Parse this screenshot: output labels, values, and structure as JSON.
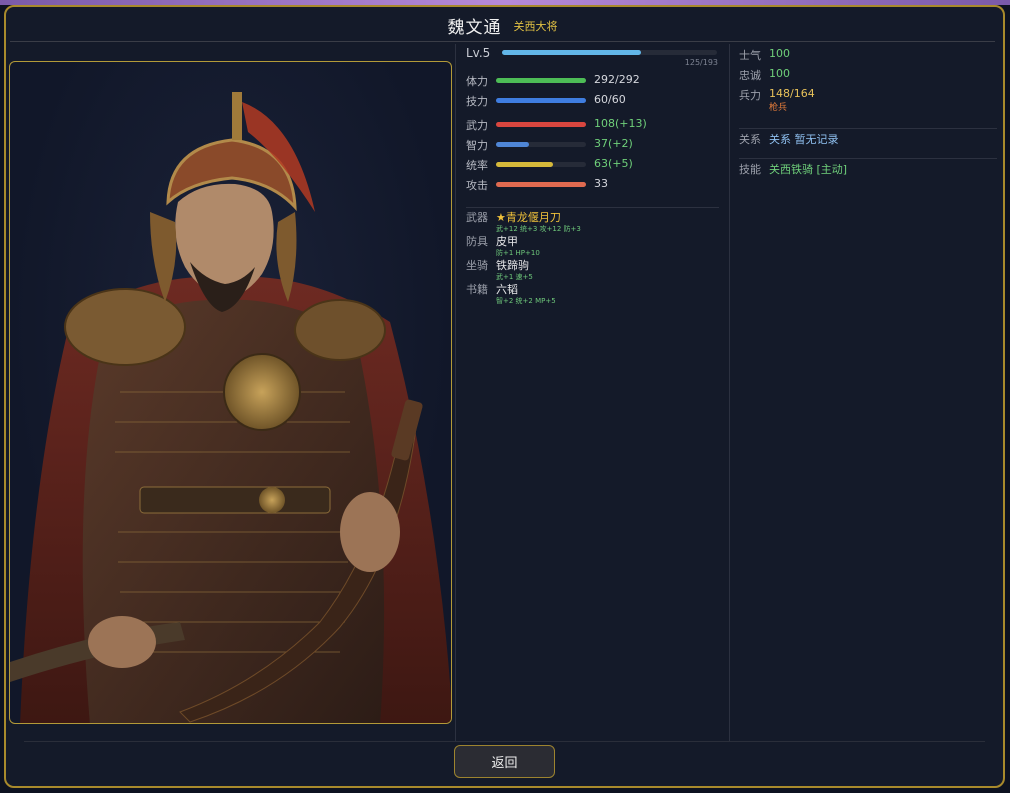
{
  "header": {
    "name": "魏文通",
    "title": "关西大将"
  },
  "level": {
    "label": "Lv.5",
    "exp": "125/193",
    "progress": 0.648
  },
  "stats": [
    {
      "label": "体力",
      "value": "292/292",
      "progress": 1.0,
      "color": "#4dbd56",
      "value_color": "#d6d8de"
    },
    {
      "label": "技力",
      "value": "60/60",
      "progress": 1.0,
      "color": "#3f7de0",
      "value_color": "#d6d8de"
    },
    {
      "label": "武力",
      "value": "108(+13)",
      "progress": 1.0,
      "color": "#d9463f",
      "value_color": "#6fd07a"
    },
    {
      "label": "智力",
      "value": "37(+2)",
      "progress": 0.37,
      "color": "#4f86d6",
      "value_color": "#6fd07a"
    },
    {
      "label": "统率",
      "value": "63(+5)",
      "progress": 0.63,
      "color": "#d6b93a",
      "value_color": "#6fd07a"
    },
    {
      "label": "攻击",
      "value": "33",
      "progress": 1.0,
      "color": "#e06a50",
      "value_color": "#d6d8de"
    }
  ],
  "equipment": [
    {
      "label": "武器",
      "name": "★青龙偃月刀",
      "bonus": "武+12 统+3 攻+12 防+3",
      "name_color": "#f0c23a"
    },
    {
      "label": "防具",
      "name": "皮甲",
      "bonus": "防+1 HP+10",
      "name_color": "#e8e8ea"
    },
    {
      "label": "坐骑",
      "name": "铁蹄驹",
      "bonus": "武+1 速+5",
      "name_color": "#e8e8ea"
    },
    {
      "label": "书籍",
      "name": "六韬",
      "bonus": "智+2 统+2 MP+5",
      "name_color": "#e8e8ea"
    }
  ],
  "side": {
    "morale": {
      "label": "士气",
      "value": "100"
    },
    "loyalty": {
      "label": "忠诚",
      "value": "100"
    },
    "troops": {
      "label": "兵力",
      "value": "148/164",
      "type": "枪兵"
    },
    "relations": {
      "label": "关系",
      "value": "关系 暂无记录"
    },
    "skill": {
      "label": "技能",
      "value": "关西铁骑 [主动]"
    }
  },
  "buttons": {
    "back": "返回"
  },
  "colors": {
    "accent_gold": "#a88a2c",
    "green": "#6fd07a",
    "orange": "#e0913a"
  }
}
